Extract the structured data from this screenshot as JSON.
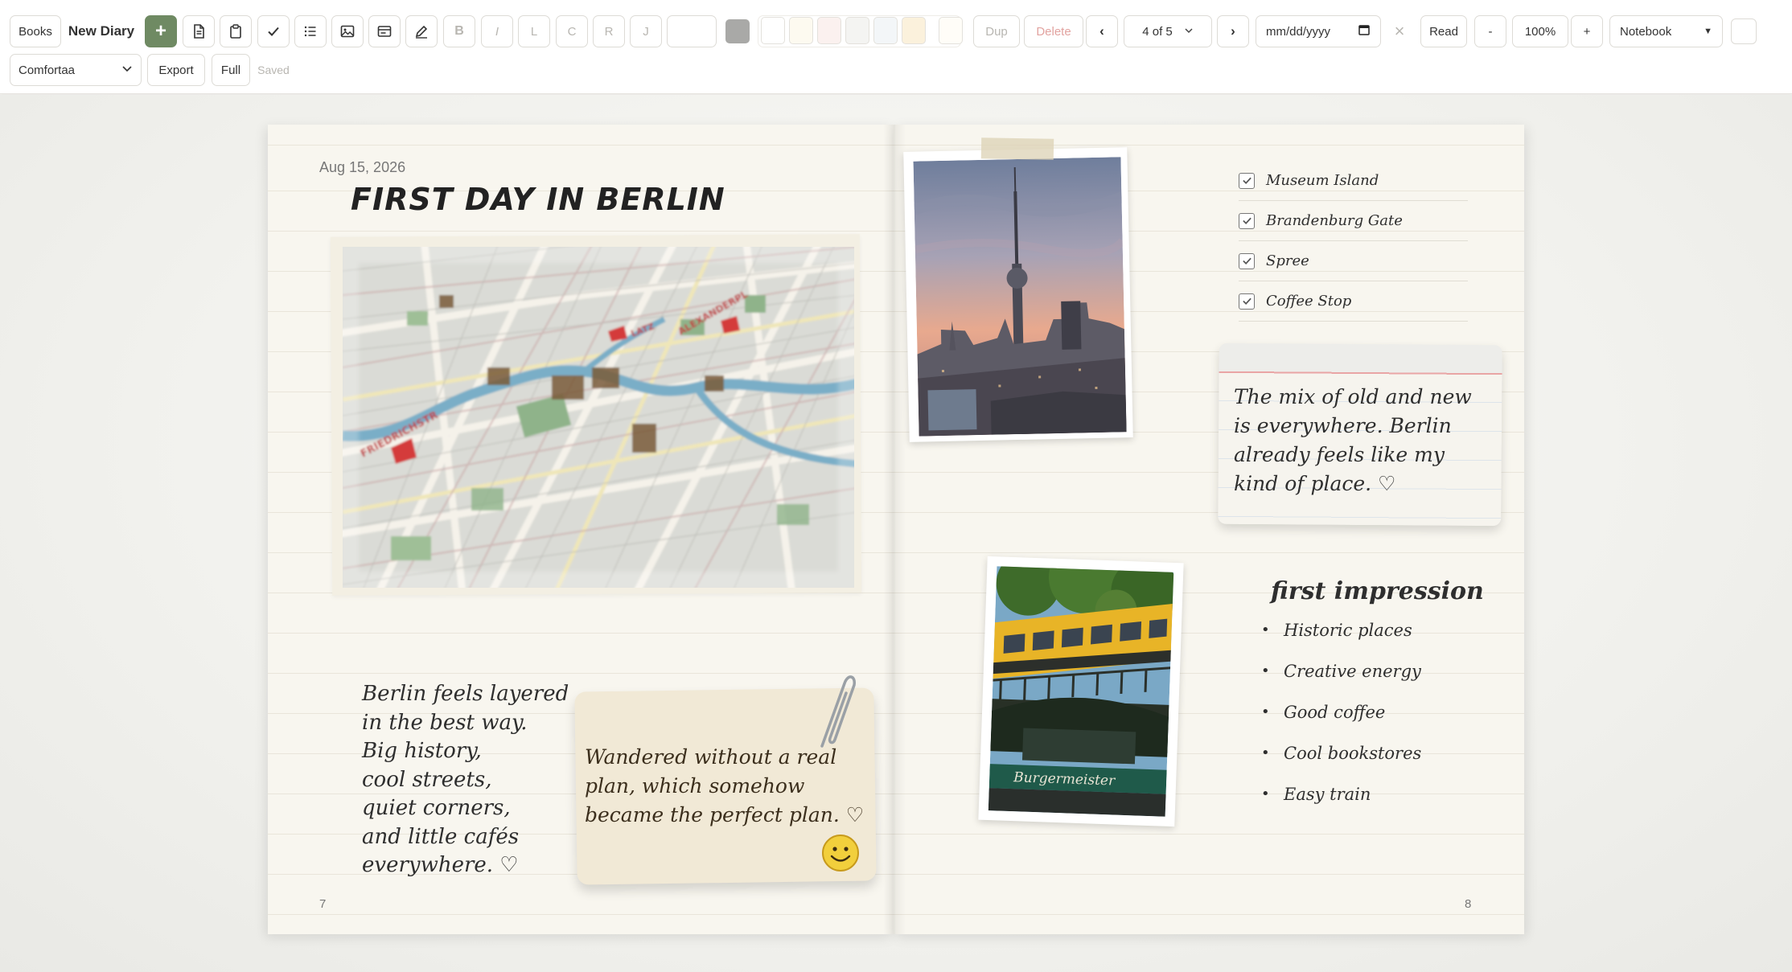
{
  "toolbar": {
    "books_label": "Books",
    "title": "New Diary",
    "add_label": "+",
    "bold_label": "B",
    "italic_label": "I",
    "align_left_label": "L",
    "align_center_label": "C",
    "align_right_label": "R",
    "align_justify_label": "J",
    "dup_label": "Dup",
    "delete_label": "Delete",
    "prev_label": "‹",
    "next_label": "›",
    "page_indicator": "4 of 5",
    "date_placeholder": "mm/dd/yyyy",
    "clear_label": "×",
    "read_label": "Read",
    "zoom_out_label": "-",
    "zoom_level": "100%",
    "zoom_in_label": "+",
    "theme_select": "Notebook",
    "font_select": "Comfortaa",
    "export_label": "Export",
    "full_label": "Full",
    "save_status": "Saved",
    "swatch_colors": [
      "#ffffff",
      "#fdfaf0",
      "#fbf1ef",
      "#f4f4f2",
      "#f3f6f8",
      "#fbf1dc",
      "#fffdf8"
    ]
  },
  "left_page": {
    "date": "Aug 15, 2026",
    "title": "FIRST DAY IN BERLIN",
    "note_lines": [
      "Berlin feels layered",
      "in the best way.",
      "Big history,",
      "cool streets,",
      "quiet corners,",
      "and little cafés",
      "everywhere. ♡"
    ],
    "sticky_text": "Wandered without a real plan, which somehow became the perfect plan. ♡",
    "page_number": "7"
  },
  "right_page": {
    "checklist": [
      {
        "label": "Museum Island",
        "checked": true
      },
      {
        "label": "Brandenburg Gate",
        "checked": true
      },
      {
        "label": "Spree",
        "checked": true
      },
      {
        "label": "Coffee Stop",
        "checked": true
      }
    ],
    "card_text": "The mix of old and new is everywhere. Berlin already feels like my kind of place. ♡",
    "impression_title": "first impression",
    "impressions": [
      "Historic places",
      "Creative energy",
      "Good coffee",
      "Cool bookstores",
      "Easy train"
    ],
    "train_sign": "Burgermeister",
    "page_number": "8"
  }
}
